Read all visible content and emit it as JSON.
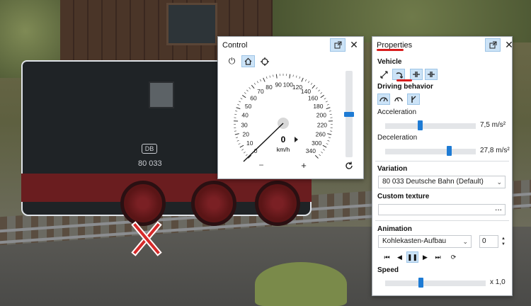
{
  "control": {
    "title": "Control",
    "speed_value": "0",
    "speed_unit": "km/h",
    "speed_ticks": [
      "0",
      "10",
      "20",
      "30",
      "40",
      "50",
      "60",
      "70",
      "80",
      "90",
      "100",
      "120",
      "140",
      "160",
      "180",
      "200",
      "220",
      "260",
      "300",
      "340"
    ],
    "minus": "−",
    "plus": "+",
    "icons": [
      "power-icon",
      "home-icon",
      "target-icon"
    ],
    "throttle_level": 0.5
  },
  "properties": {
    "title": "Properties",
    "vehicle": {
      "label": "Vehicle",
      "buttons": [
        "resize-icon",
        "rotate-icon",
        "couple-left-icon",
        "couple-right-icon"
      ]
    },
    "driving_behavior": {
      "label": "Driving behavior",
      "buttons": [
        "speed-gauge-icon",
        "gauge-alt-icon",
        "direction-icon"
      ]
    },
    "acceleration": {
      "label": "Acceleration",
      "value": "7,5 m/s²",
      "level": 0.38
    },
    "deceleration": {
      "label": "Deceleration",
      "value": "27,8 m/s²",
      "level": 0.72
    },
    "variation": {
      "label": "Variation",
      "selected": "80 033 Deutsche Bahn (Default)"
    },
    "custom_texture": {
      "label": "Custom texture",
      "browse": "..."
    },
    "animation": {
      "label": "Animation",
      "selected": "Kohlekasten-Aufbau",
      "number": "0"
    },
    "media_buttons": [
      "first-frame-icon",
      "previous-icon",
      "pause-icon",
      "play-icon",
      "last-frame-icon",
      "loop-icon"
    ],
    "speed": {
      "label": "Speed",
      "value": "x 1,0",
      "level": 0.35
    }
  },
  "scene": {
    "loco_number": "80 033",
    "loco_logo": "DB"
  },
  "colors": {
    "accent": "#1e7bd4",
    "highlight": "#cce3f7",
    "red_marker": "#d81e1e"
  }
}
